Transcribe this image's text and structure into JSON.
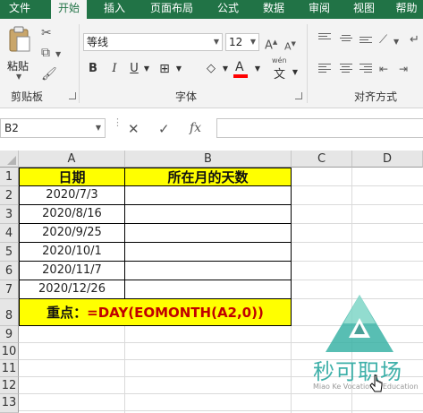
{
  "tabs": [
    "文件",
    "开始",
    "插入",
    "页面布局",
    "公式",
    "数据",
    "审阅",
    "视图",
    "帮助"
  ],
  "active_tab": "开始",
  "clipboard": {
    "paste_label": "粘贴",
    "group_label": "剪贴板"
  },
  "font": {
    "font_name": "等线",
    "font_size": "12",
    "bold": "B",
    "italic": "I",
    "underline": "U",
    "wen_label": "wén",
    "wen_char": "文",
    "group_label": "字体",
    "color_accent": "#ff0000"
  },
  "alignment": {
    "group_label": "对齐方式"
  },
  "formula_bar": {
    "name_box": "B2",
    "cancel": "✕",
    "enter": "✓",
    "fx": "fx",
    "content": ""
  },
  "columns": [
    "A",
    "B",
    "C",
    "D"
  ],
  "rows": [
    "1",
    "2",
    "3",
    "4",
    "5",
    "6",
    "7",
    "8",
    "9",
    "10",
    "11",
    "12",
    "13"
  ],
  "table": {
    "header_a": "日期",
    "header_b": "所在月的天数",
    "dates": [
      "2020/7/3",
      "2020/8/16",
      "2020/9/25",
      "2020/10/1",
      "2020/11/7",
      "2020/12/26"
    ],
    "note_prefix": "重点：",
    "note_formula": "=DAY(EOMONTH(A2,0))"
  },
  "watermark": {
    "brand": "秒可职场",
    "tagline": "Miao Ke Vocational Education"
  },
  "colors": {
    "ribbon_green": "#217346",
    "highlight_yellow": "#ffff00",
    "formula_red": "#c00000"
  }
}
